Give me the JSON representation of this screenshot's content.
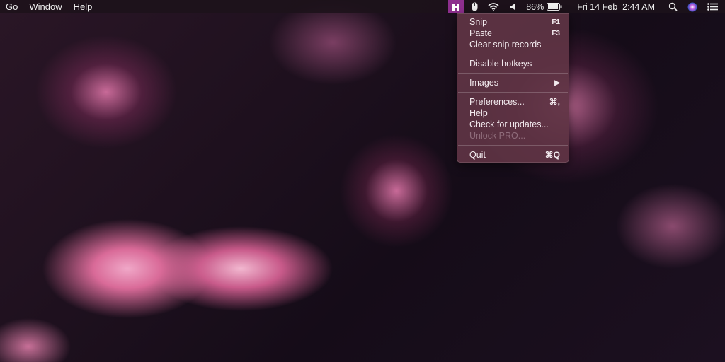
{
  "menubar": {
    "left": [
      "Go",
      "Window",
      "Help"
    ],
    "battery": "86%",
    "datetime": "Fri 14 Feb  2:44 AM"
  },
  "menu": {
    "snip": {
      "label": "Snip",
      "shortcut": "F1"
    },
    "paste": {
      "label": "Paste",
      "shortcut": "F3"
    },
    "clear": {
      "label": "Clear snip records"
    },
    "disable": {
      "label": "Disable hotkeys"
    },
    "images": {
      "label": "Images",
      "shortcut": "▶"
    },
    "prefs": {
      "label": "Preferences...",
      "shortcut": "⌘,"
    },
    "help": {
      "label": "Help"
    },
    "updates": {
      "label": "Check for updates..."
    },
    "unlock": {
      "label": "Unlock PRO..."
    },
    "quit": {
      "label": "Quit",
      "shortcut": "⌘Q"
    }
  }
}
